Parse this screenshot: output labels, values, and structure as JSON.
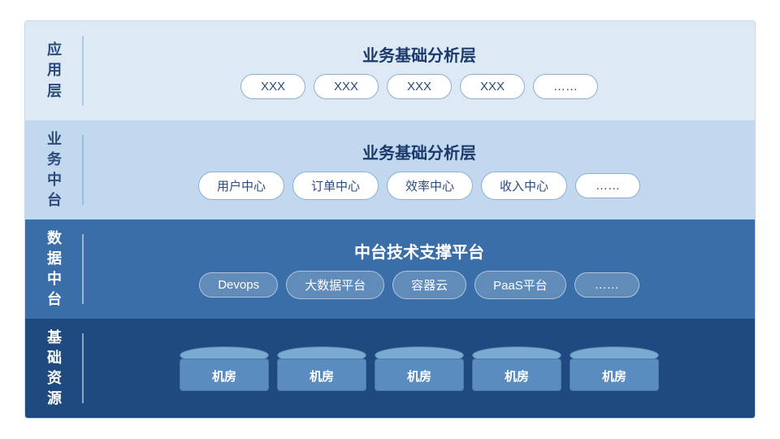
{
  "layers": [
    {
      "id": "app",
      "label": "应\n用\n层",
      "title": "业务基础分析层",
      "type": "cards",
      "cards": [
        "XXX",
        "XXX",
        "XXX",
        "XXX",
        "……"
      ]
    },
    {
      "id": "biz",
      "label": "业\n务\n中\n台",
      "title": "业务基础分析层",
      "type": "cards",
      "cards": [
        "用户中心",
        "订单中心",
        "效率中心",
        "收入中心",
        "……"
      ]
    },
    {
      "id": "data",
      "label": "数\n据\n中\n台",
      "title": "中台技术支撑平台",
      "type": "cards-dark",
      "cards": [
        "Devops",
        "大数据平台",
        "容器云",
        "PaaS平台",
        "……"
      ]
    },
    {
      "id": "infra",
      "label": "基\n础\n资\n源",
      "title": "",
      "type": "cylinders",
      "cards": [
        "机房",
        "机房",
        "机房",
        "机房",
        "机房"
      ]
    }
  ],
  "colors": {
    "app_bg": "#ddeaf5",
    "biz_bg": "#c2d8ef",
    "data_bg": "#3a6ea8",
    "infra_bg": "#1e4a80"
  }
}
